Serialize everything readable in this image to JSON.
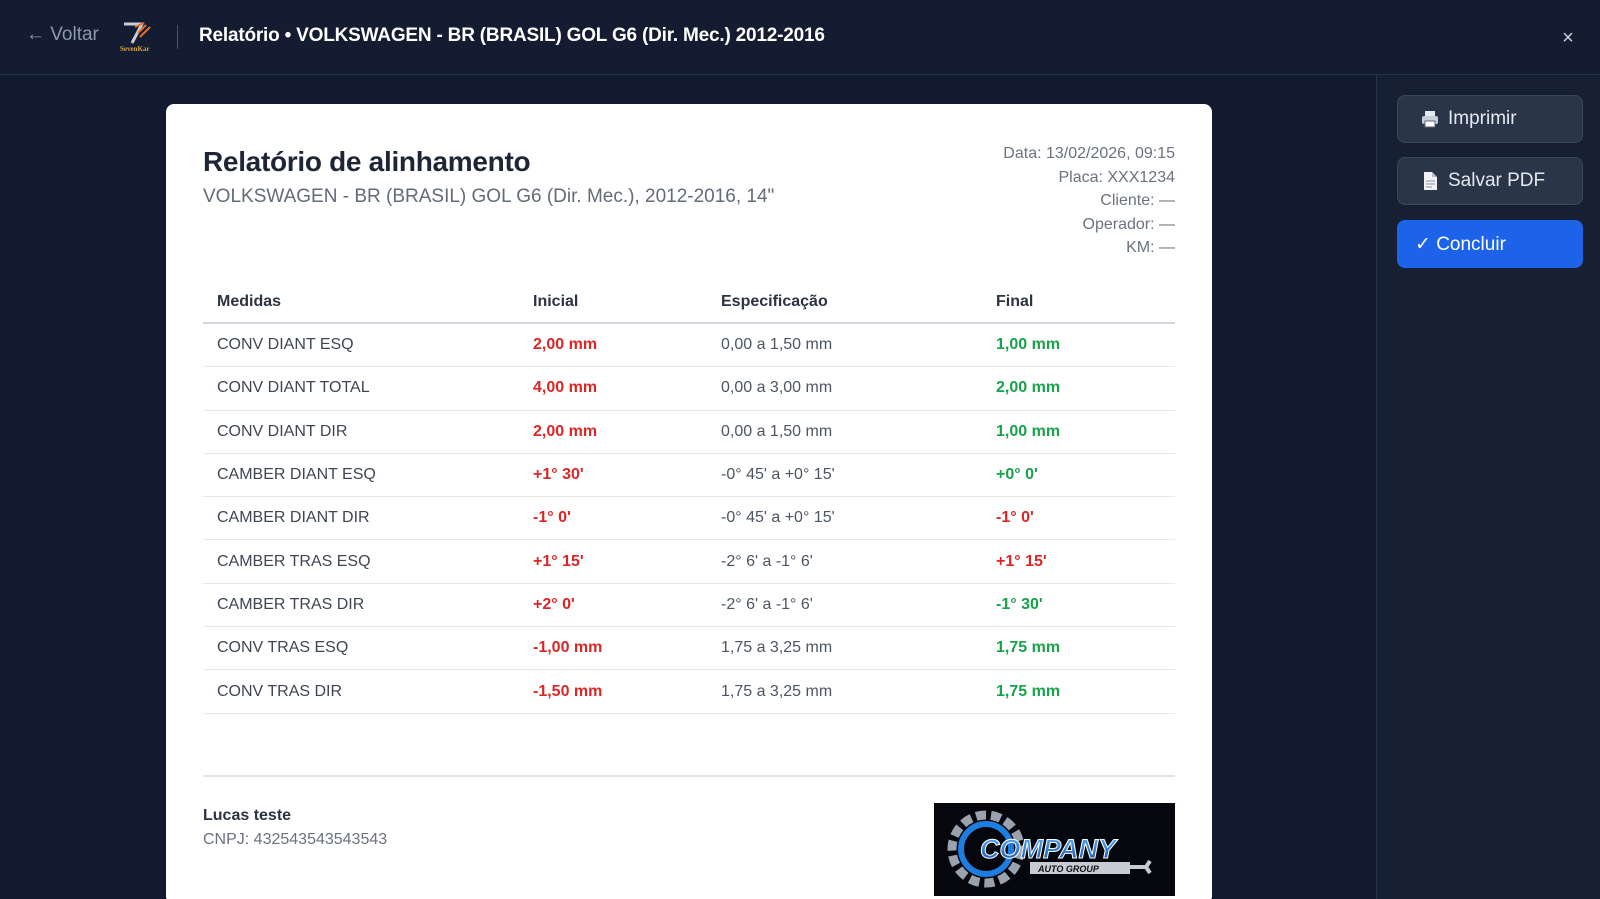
{
  "header": {
    "back_label": "← Voltar",
    "brand_logo_text": "SevenKar",
    "title": "Relatório • VOLKSWAGEN - BR (BRASIL) GOL G6 (Dir. Mec.) 2012-2016",
    "close_label": "×"
  },
  "sidebar": {
    "print_label": "Imprimir",
    "pdf_label": "Salvar PDF",
    "done_label": "✓ Concluir",
    "print_icon": "printer-icon",
    "pdf_icon": "document-icon",
    "accent_color": "#1d63ea"
  },
  "report": {
    "title": "Relatório de alinhamento",
    "subtitle": "VOLKSWAGEN - BR (BRASIL) GOL G6 (Dir. Mec.), 2012-2016, 14\"",
    "meta": {
      "date": "Data: 13/02/2026, 09:15",
      "plate": "Placa: XXX1234",
      "client": "Cliente: —",
      "operator": "Operador: —",
      "km": "KM: —"
    },
    "table": {
      "headers": [
        "Medidas",
        "Inicial",
        "Especificação",
        "Final"
      ],
      "rows": [
        {
          "measure": "CONV DIANT ESQ",
          "initial": "2,00 mm",
          "initial_status": "red",
          "spec": "0,00 a 1,50 mm",
          "final": "1,00 mm",
          "final_status": "green"
        },
        {
          "measure": "CONV DIANT TOTAL",
          "initial": "4,00 mm",
          "initial_status": "red",
          "spec": "0,00 a 3,00 mm",
          "final": "2,00 mm",
          "final_status": "green"
        },
        {
          "measure": "CONV DIANT DIR",
          "initial": "2,00 mm",
          "initial_status": "red",
          "spec": "0,00 a 1,50 mm",
          "final": "1,00 mm",
          "final_status": "green"
        },
        {
          "measure": "CAMBER DIANT ESQ",
          "initial": "+1° 30'",
          "initial_status": "red",
          "spec": "-0° 45' a +0° 15'",
          "final": "+0° 0'",
          "final_status": "green"
        },
        {
          "measure": "CAMBER DIANT DIR",
          "initial": "-1° 0'",
          "initial_status": "red",
          "spec": "-0° 45' a +0° 15'",
          "final": "-1° 0'",
          "final_status": "red"
        },
        {
          "measure": "CAMBER TRAS ESQ",
          "initial": "+1° 15'",
          "initial_status": "red",
          "spec": "-2° 6' a -1° 6'",
          "final": "+1° 15'",
          "final_status": "red"
        },
        {
          "measure": "CAMBER TRAS DIR",
          "initial": "+2° 0'",
          "initial_status": "red",
          "spec": "-2° 6' a -1° 6'",
          "final": "-1° 30'",
          "final_status": "green"
        },
        {
          "measure": "CONV TRAS ESQ",
          "initial": "-1,00 mm",
          "initial_status": "red",
          "spec": "1,75 a 3,25 mm",
          "final": "1,75 mm",
          "final_status": "green"
        },
        {
          "measure": "CONV TRAS DIR",
          "initial": "-1,50 mm",
          "initial_status": "red",
          "spec": "1,75 a 3,25 mm",
          "final": "1,75 mm",
          "final_status": "green"
        }
      ]
    },
    "company": {
      "name": "Lucas teste",
      "cnpj": "CNPJ: 432543543543543",
      "logo_text": "COMPANY",
      "logo_subtext": "AUTO GROUP"
    },
    "status_colors": {
      "red": "#dc2626",
      "green": "#16a34a"
    }
  }
}
